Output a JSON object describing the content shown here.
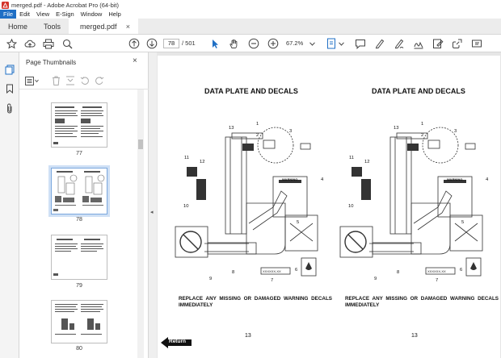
{
  "window": {
    "title": "merged.pdf - Adobe Acrobat Pro (64-bit)"
  },
  "menu": [
    "File",
    "Edit",
    "View",
    "E-Sign",
    "Window",
    "Help"
  ],
  "tabs": {
    "home": "Home",
    "tools": "Tools",
    "document": "merged.pdf",
    "close": "×"
  },
  "toolbar": {
    "page_current": "78",
    "page_total": "/ 501",
    "zoom": "67.2%"
  },
  "thumbnails": {
    "header": "Page Thumbnails",
    "close": "×",
    "pages": [
      {
        "label": "77"
      },
      {
        "label": "78"
      },
      {
        "label": "79"
      },
      {
        "label": "80"
      }
    ]
  },
  "document": {
    "left": {
      "title": "DATA PLATE AND DECALS",
      "warning": "REPLACE ANY MISSING OR DAMAGED WARNING DECALS IMMEDIATELY",
      "page_number": "13"
    },
    "right": {
      "title": "DATA PLATE AND DECALS",
      "warning": "REPLACE ANY MISSING OR DAMAGED WARNING DECALS IMMEDIATELY",
      "page_number": "13"
    },
    "callouts": [
      "1",
      "2",
      "3",
      "4",
      "5",
      "6",
      "7",
      "8",
      "9",
      "10",
      "11",
      "12",
      "13"
    ],
    "decal_code": "XXXXXX-XX",
    "warning_decal": "WARNING",
    "return_label": "Return"
  },
  "colors": {
    "accent": "#1f6fc5",
    "acrobat_red": "#d4342b"
  }
}
